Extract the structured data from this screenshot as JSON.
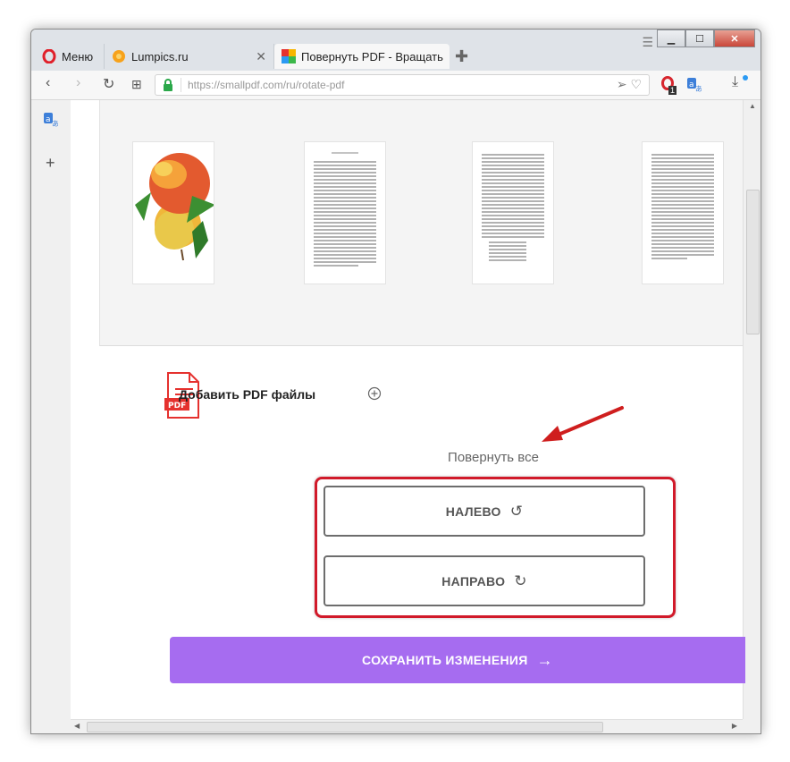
{
  "browser": {
    "tabs": [
      {
        "label": "Меню",
        "icon": "opera-icon"
      },
      {
        "label": "Lumpics.ru",
        "icon": "orange-icon"
      },
      {
        "label": "Повернуть PDF - Вращать",
        "icon": "smallpdf-icon",
        "active": true
      }
    ],
    "address": "https://smallpdf.com/ru/rotate-pdf",
    "badge_count": "1"
  },
  "page": {
    "add_files_label": "Добавить PDF файлы",
    "pdf_icon_label": "PDF",
    "rotate_all_label": "Повернуть все",
    "left_button": "НАЛЕВО",
    "right_button": "НАПРАВО",
    "save_button": "СОХРАНИТЬ ИЗМЕНЕНИЯ"
  },
  "colors": {
    "accent_purple": "#a66cf0",
    "highlight_red": "#d11a2a",
    "pdf_red": "#e5312e"
  }
}
